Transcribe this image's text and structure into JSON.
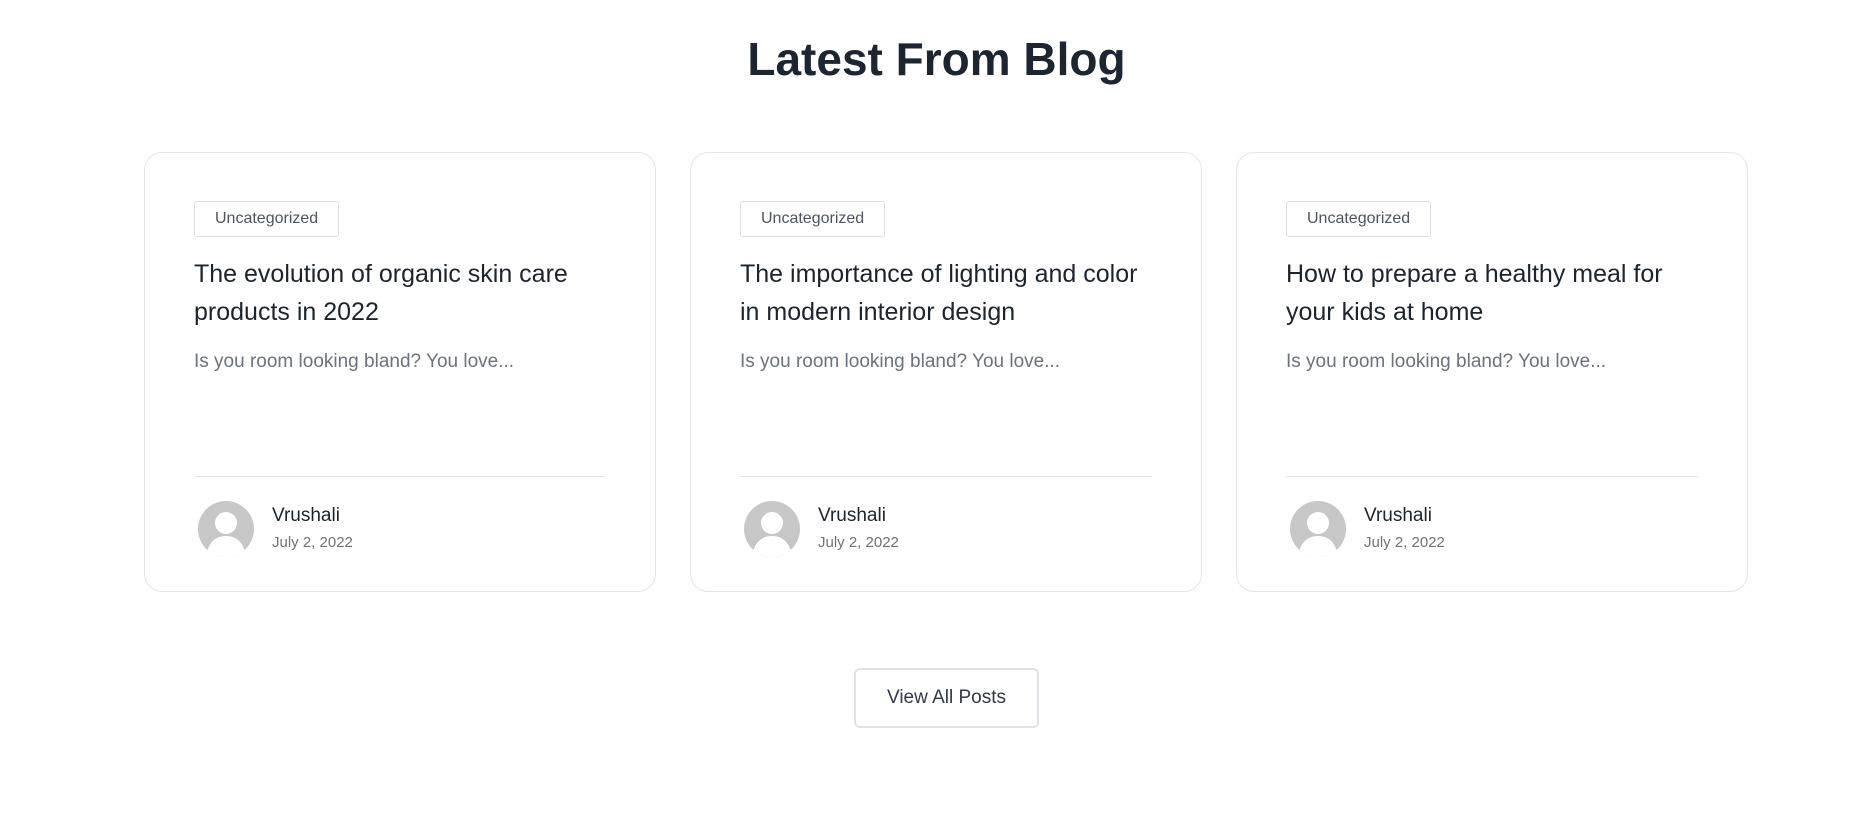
{
  "section": {
    "title": "Latest From Blog"
  },
  "posts": [
    {
      "category": "Uncategorized",
      "title": "The evolution of organic skin care products in 2022",
      "excerpt": "Is you room looking bland? You love...",
      "author": "Vrushali",
      "date": "July 2, 2022",
      "avatar_icon": "user-silhouette-icon"
    },
    {
      "category": "Uncategorized",
      "title": "The importance of lighting and color in modern interior design",
      "excerpt": "Is you room looking bland? You love...",
      "author": "Vrushali",
      "date": "July 2, 2022",
      "avatar_icon": "user-silhouette-icon"
    },
    {
      "category": "Uncategorized",
      "title": "How to prepare a healthy meal for your kids at home",
      "excerpt": "Is you room looking bland? You love...",
      "author": "Vrushali",
      "date": "July 2, 2022",
      "avatar_icon": "user-silhouette-icon"
    }
  ],
  "actions": {
    "view_all_label": "View All Posts"
  },
  "colors": {
    "heading": "#1c2633",
    "body_text": "#1b2430",
    "muted_text": "#6b7280",
    "card_border": "#e3e5e8",
    "avatar_bg": "#c7c7c7"
  }
}
